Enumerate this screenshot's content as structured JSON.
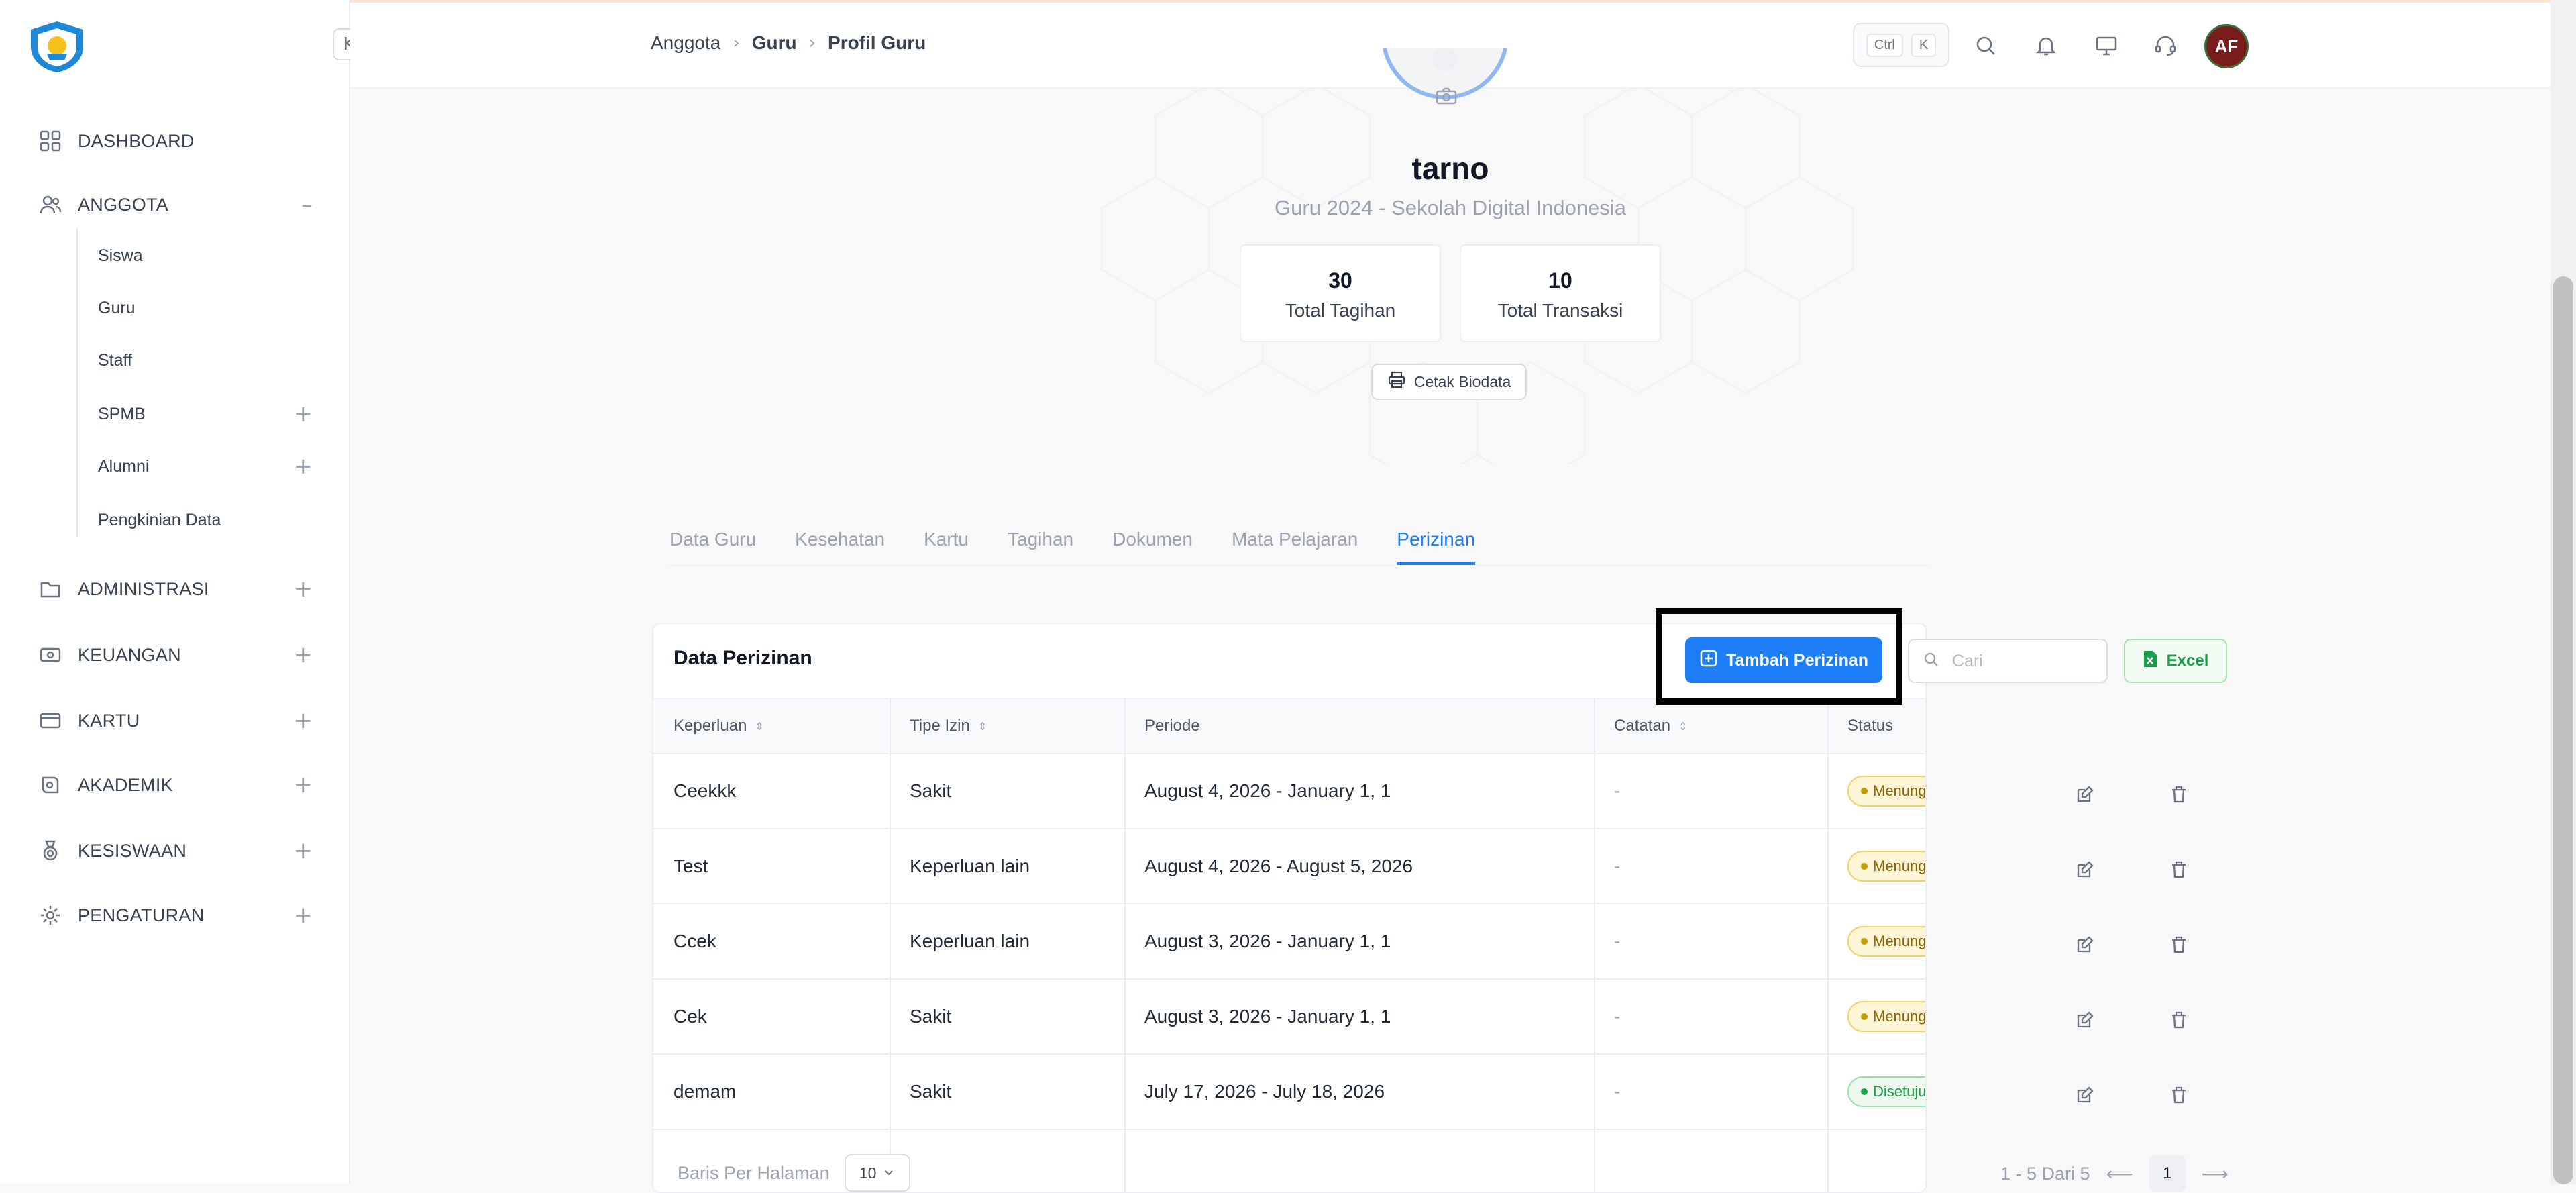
{
  "sidebar": {
    "items": [
      {
        "label": "DASHBOARD",
        "icon": "grid-icon",
        "toggle": ""
      },
      {
        "label": "ANGGOTA",
        "icon": "users-icon",
        "toggle": "–"
      },
      {
        "label": "ADMINISTRASI",
        "icon": "folder-icon",
        "toggle": "+"
      },
      {
        "label": "KEUANGAN",
        "icon": "money-icon",
        "toggle": "+"
      },
      {
        "label": "KARTU",
        "icon": "card-icon",
        "toggle": "+"
      },
      {
        "label": "AKADEMIK",
        "icon": "academic-icon",
        "toggle": "+"
      },
      {
        "label": "KESISWAAN",
        "icon": "medal-icon",
        "toggle": "+"
      },
      {
        "label": "PENGATURAN",
        "icon": "gear-icon",
        "toggle": "+"
      }
    ],
    "sub_items": [
      {
        "label": "Siswa",
        "toggle": ""
      },
      {
        "label": "Guru",
        "toggle": ""
      },
      {
        "label": "Staff",
        "toggle": ""
      },
      {
        "label": "SPMB",
        "toggle": "+"
      },
      {
        "label": "Alumni",
        "toggle": "+"
      },
      {
        "label": "Pengkinian Data",
        "toggle": ""
      }
    ],
    "collapse_glyph": "K"
  },
  "header": {
    "breadcrumb": [
      "Anggota",
      "Guru",
      "Profil Guru"
    ],
    "separator": "›",
    "shortcut_keys": [
      "Ctrl",
      "K"
    ],
    "avatar_initials": "AF"
  },
  "profile": {
    "name": "tarno",
    "subtitle": "Guru 2024 - Sekolah Digital Indonesia",
    "stats": [
      {
        "value": "30",
        "label": "Total Tagihan"
      },
      {
        "value": "10",
        "label": "Total Transaksi"
      }
    ],
    "print_label": "Cetak Biodata"
  },
  "tabs": [
    "Data Guru",
    "Kesehatan",
    "Kartu",
    "Tagihan",
    "Dokumen",
    "Mata Pelajaran",
    "Perizinan"
  ],
  "active_tab": "Perizinan",
  "table": {
    "title": "Data Perizinan",
    "add_label": "Tambah Perizinan",
    "search_placeholder": "Cari",
    "excel_label": "Excel",
    "columns": [
      "Keperluan",
      "Tipe Izin",
      "Periode",
      "Catatan",
      "Status"
    ],
    "rows": [
      {
        "keperluan": "Ceekkk",
        "tipe": "Sakit",
        "periode": "August 4, 2026 - January 1, 1",
        "catatan": "-",
        "status": "Menunggu"
      },
      {
        "keperluan": "Test",
        "tipe": "Keperluan lain",
        "periode": "August 4, 2026 - August 5, 2026",
        "catatan": "-",
        "status": "Menunggu"
      },
      {
        "keperluan": "Ccek",
        "tipe": "Keperluan lain",
        "periode": "August 3, 2026 - January 1, 1",
        "catatan": "-",
        "status": "Menunggu"
      },
      {
        "keperluan": "Cek",
        "tipe": "Sakit",
        "periode": "August 3, 2026 - January 1, 1",
        "catatan": "-",
        "status": "Menunggu"
      },
      {
        "keperluan": "demam",
        "tipe": "Sakit",
        "periode": "July 17, 2026 - July 18, 2026",
        "catatan": "-",
        "status": "Disetujui"
      }
    ]
  },
  "pagination": {
    "rows_per_page_label": "Baris Per Halaman",
    "rows_per_page": "10",
    "range_text": "1 - 5 Dari 5",
    "current_page": "1"
  },
  "colors": {
    "primary": "#1d7ef7",
    "status_waiting": "#f2d06b",
    "status_approved": "#18a149",
    "excel": "#1a9d4b",
    "avatar_bg": "#7b1c1c"
  }
}
